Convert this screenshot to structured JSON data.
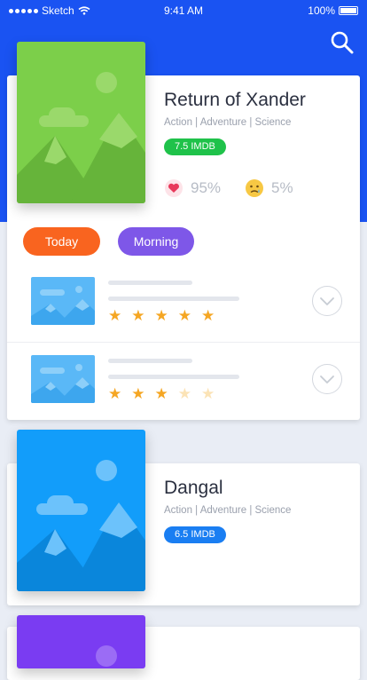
{
  "status_bar": {
    "carrier": "Sketch",
    "time": "9:41 AM",
    "battery": "100%"
  },
  "icons": {
    "search": "search-icon",
    "heart": "heart-icon",
    "sad_face": "sad-face-icon",
    "chevron": "chevron-down-icon",
    "star": "star-icon"
  },
  "movies": [
    {
      "title": "Return of Xander",
      "genres": "Action | Adventure | Science",
      "rating": "7.5 IMDB",
      "like_percent": "95%",
      "dislike_percent": "5%"
    },
    {
      "title": "Dangal",
      "genres": "Action | Adventure | Science",
      "rating": "6.5 IMDB"
    }
  ],
  "filters": {
    "today": "Today",
    "morning": "Morning"
  },
  "showtimes": [
    {
      "stars": 5
    },
    {
      "stars": 3
    }
  ],
  "colors": {
    "header_blue": "#1a53f2",
    "today_orange": "#f9641f",
    "morning_purple": "#7e57e8",
    "imdb_green": "#1fc24a",
    "imdb_blue": "#1a7ef2",
    "star_gold": "#f5a623"
  }
}
